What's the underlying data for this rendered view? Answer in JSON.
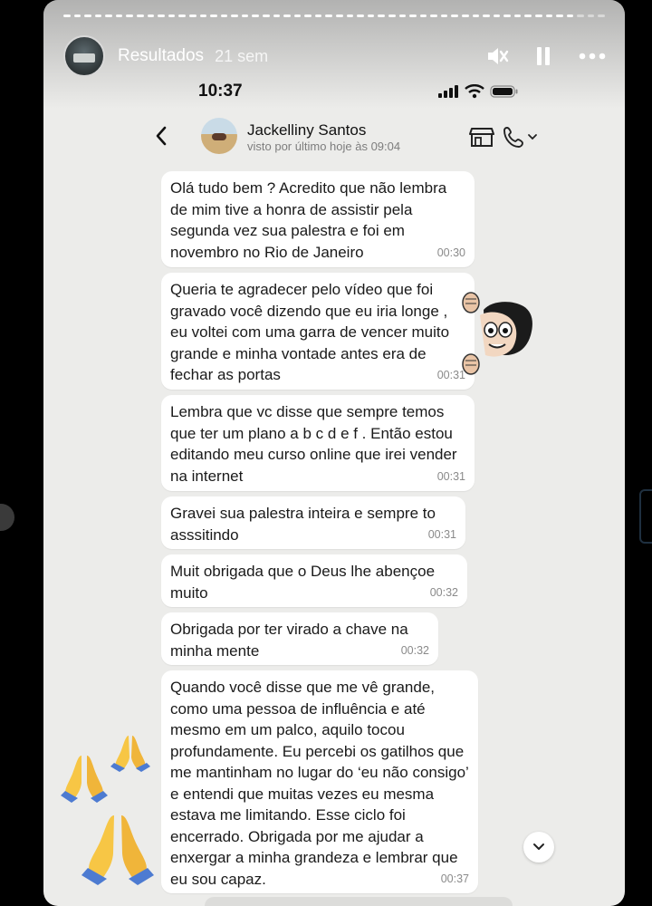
{
  "story": {
    "title": "Resultados",
    "age": "21 sem",
    "controls": [
      "mute-icon",
      "pause-icon",
      "more-icon"
    ]
  },
  "status_bar": {
    "time": "10:37"
  },
  "chat_header": {
    "contact_name": "Jackelliny Santos",
    "contact_status": "visto por último hoje às 09:04"
  },
  "messages": [
    {
      "text": "Olá tudo bem ? Acredito que não lembra de mim tive a honra de assistir pela segunda vez sua palestra e foi em novembro no Rio de Janeiro",
      "time": "00:30"
    },
    {
      "text": "Queria te agradecer pelo vídeo que foi gravado você dizendo que eu iria longe , eu voltei com uma garra de vencer muito grande e minha vontade antes era de fechar as portas",
      "time": "00:31"
    },
    {
      "text": "Lembra que vc disse que sempre temos que ter um plano a b c d e f . Então estou editando meu curso online que irei vender na internet",
      "time": "00:31"
    },
    {
      "text": "Gravei sua palestra inteira e sempre to asssitindo",
      "time": "00:31"
    },
    {
      "text": "Muit obrigada que o Deus lhe abençoe muito",
      "time": "00:32"
    },
    {
      "text": "Obrigada por ter virado a chave na minha mente",
      "time": "00:32"
    },
    {
      "text": "Quando você disse que me vê grande, como uma pessoa de influência e até mesmo em um palco, aquilo tocou profundamente. Eu percebi os gatilhos que me mantinham no lugar do ‘eu não consigo’ e entendi que muitas vezes eu mesma estava me limitando. Esse ciclo foi encerrado. Obrigada por me ajudar a enxergar a minha grandeza e lembrar que eu sou capaz.",
      "time": "00:37"
    }
  ],
  "colors": {
    "chat_background": "#ececea",
    "bubble": "#ffffff",
    "timestamp": "#8a8a8a"
  },
  "icons": [
    "back-icon",
    "shop-icon",
    "call-icon",
    "chevron-down-icon",
    "folded-hands-icon"
  ]
}
